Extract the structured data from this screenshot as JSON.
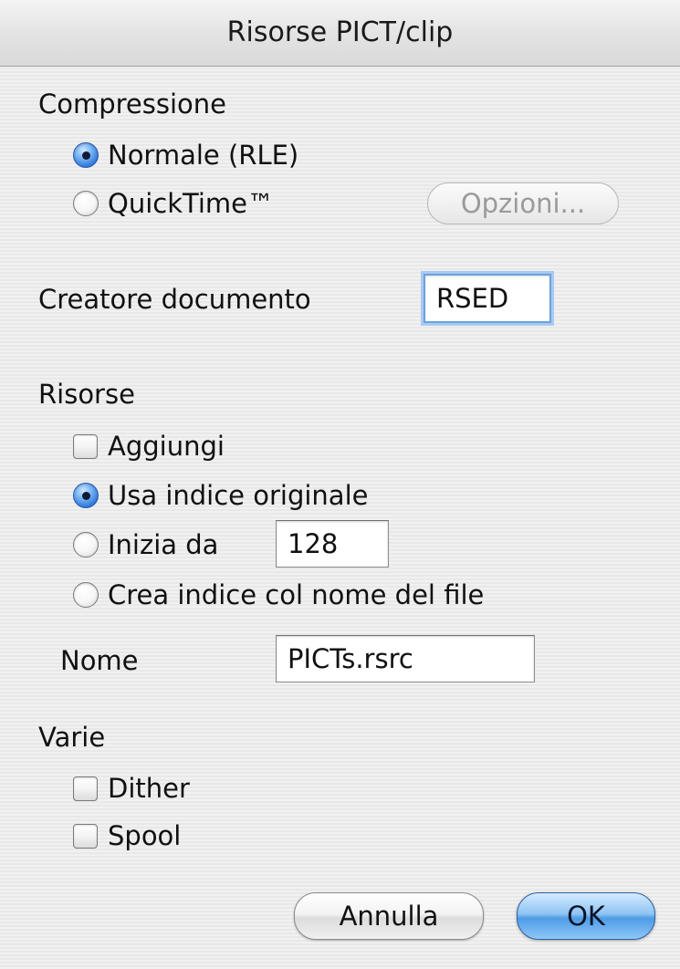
{
  "dialog": {
    "title": "Risorse PICT/clip"
  },
  "compression": {
    "heading": "Compressione",
    "normal_label": "Normale (RLE)",
    "normal_selected": true,
    "quicktime_label": "QuickTime™",
    "quicktime_selected": false,
    "options_button": "Opzioni...",
    "options_enabled": false
  },
  "creator": {
    "label": "Creatore documento",
    "value": "RSED"
  },
  "resources": {
    "heading": "Risorse",
    "add_label": "Aggiungi",
    "add_checked": false,
    "use_original_label": "Usa indice originale",
    "use_original_selected": true,
    "start_from_label": "Inizia da",
    "start_from_selected": false,
    "start_from_value": "128",
    "from_filename_label": "Crea indice col nome del file",
    "from_filename_selected": false,
    "name_label": "Nome",
    "name_value": "PICTs.rsrc"
  },
  "misc": {
    "heading": "Varie",
    "dither_label": "Dither",
    "dither_checked": false,
    "spool_label": "Spool",
    "spool_checked": false
  },
  "buttons": {
    "cancel": "Annulla",
    "ok": "OK"
  },
  "colors": {
    "accent": "#4f9be6",
    "window_background": "#ececec"
  }
}
